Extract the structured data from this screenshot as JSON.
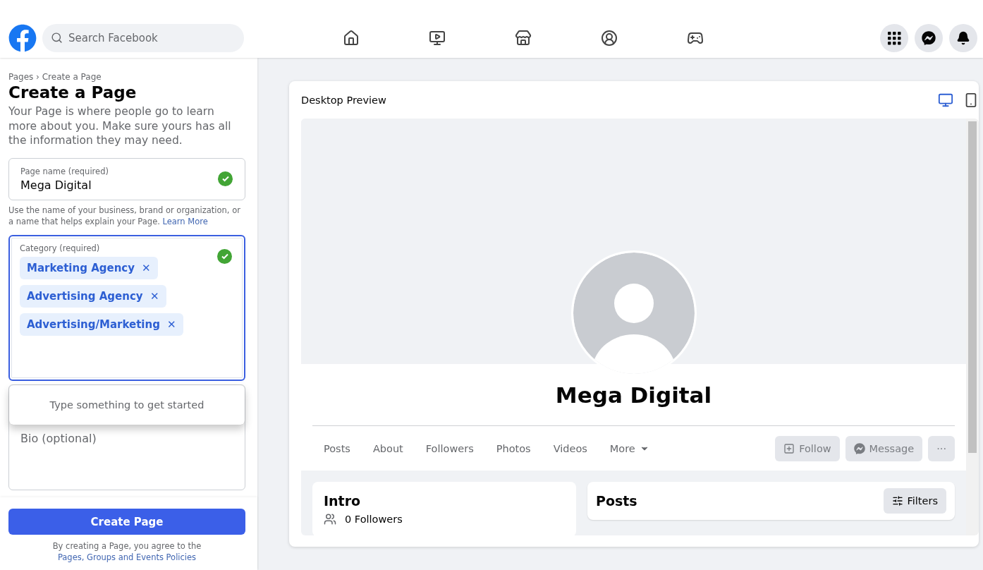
{
  "header": {
    "search": {
      "placeholder": "Search Facebook"
    }
  },
  "create_panel": {
    "breadcrumb": "Pages › Create a Page",
    "title": "Create a Page",
    "description": "Your Page is where people go to learn more about you. Make sure yours has all the information they may need.",
    "page_name": {
      "label": "Page name (required)",
      "value": "Mega Digital",
      "valid": true,
      "focused": false
    },
    "page_name_help": {
      "text": "Use the name of your business, brand or organization, or a name that helps explain your Page.",
      "link": "Learn More"
    },
    "category": {
      "label": "Category (required)",
      "valid": true,
      "focused": true,
      "tags": [
        {
          "label": "Marketing Agency",
          "remove": "✕"
        },
        {
          "label": "Advertising Agency",
          "remove": "✕"
        },
        {
          "label": "Advertising/Marketing",
          "remove": "✕"
        }
      ]
    },
    "category_dropdown": {
      "message": "Type something to get started"
    },
    "bio": {
      "placeholder": "Bio (optional)"
    },
    "create_button": "Create Page",
    "terms": {
      "text": "By creating a Page, you agree to the",
      "link": "Pages, Groups and Events Policies"
    }
  },
  "preview": {
    "title": "Desktop Preview",
    "views": [
      {
        "kind": "desktop",
        "selected": true
      },
      {
        "kind": "mobile",
        "selected": false
      }
    ],
    "page_name": "Mega Digital",
    "tabs": [
      {
        "label": "Posts",
        "dropdown": false
      },
      {
        "label": "About",
        "dropdown": false
      },
      {
        "label": "Followers",
        "dropdown": false
      },
      {
        "label": "Photos",
        "dropdown": false
      },
      {
        "label": "Videos",
        "dropdown": false
      },
      {
        "label": "More",
        "dropdown": true
      }
    ],
    "actions": [
      {
        "kind": "follow",
        "label": "Follow",
        "disabled": true
      },
      {
        "kind": "message",
        "label": "Message",
        "disabled": true
      },
      {
        "kind": "more",
        "label": "···",
        "disabled": true
      }
    ],
    "intro": {
      "title": "Intro",
      "followers": "0 Followers"
    },
    "posts": {
      "title": "Posts",
      "filters": "Filters"
    }
  }
}
